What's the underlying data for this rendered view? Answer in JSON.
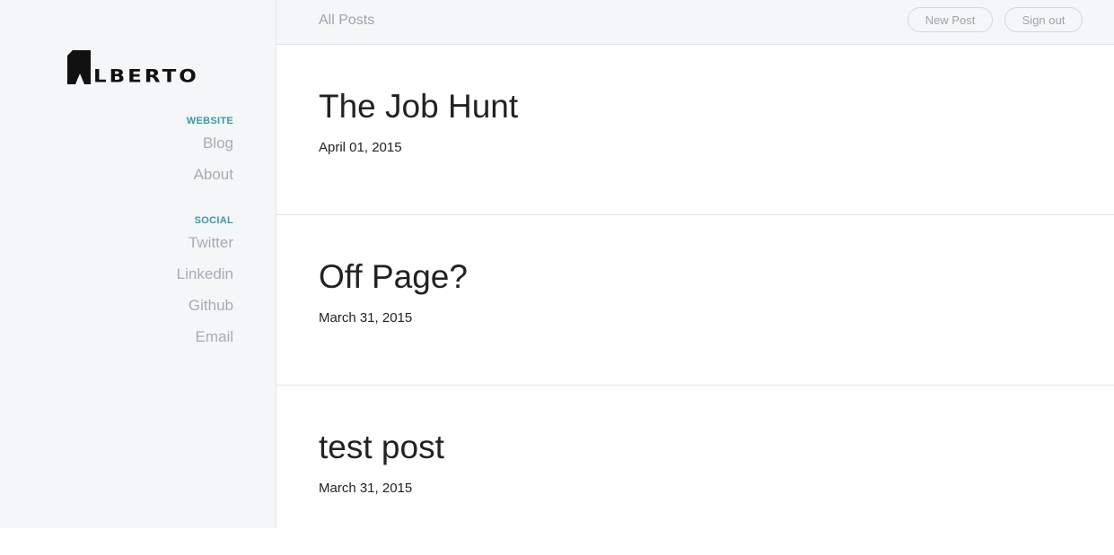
{
  "brand": {
    "logo_text": "LBERTO"
  },
  "sidebar": {
    "sections": [
      {
        "heading": "WEBSITE",
        "links": [
          "Blog",
          "About"
        ]
      },
      {
        "heading": "SOCIAL",
        "links": [
          "Twitter",
          "Linkedin",
          "Github",
          "Email"
        ]
      }
    ]
  },
  "topbar": {
    "title": "All Posts",
    "new_post_label": "New Post",
    "sign_out_label": "Sign out"
  },
  "posts": [
    {
      "title": "The Job Hunt",
      "date": "April 01, 2015"
    },
    {
      "title": "Off Page?",
      "date": "March 31, 2015"
    },
    {
      "title": "test post",
      "date": "March 31, 2015"
    }
  ],
  "colors": {
    "accent": "#3a9aa3",
    "sidebar_bg": "#f5f6f8",
    "muted_text": "#a3acb5",
    "body_text": "#222222"
  }
}
